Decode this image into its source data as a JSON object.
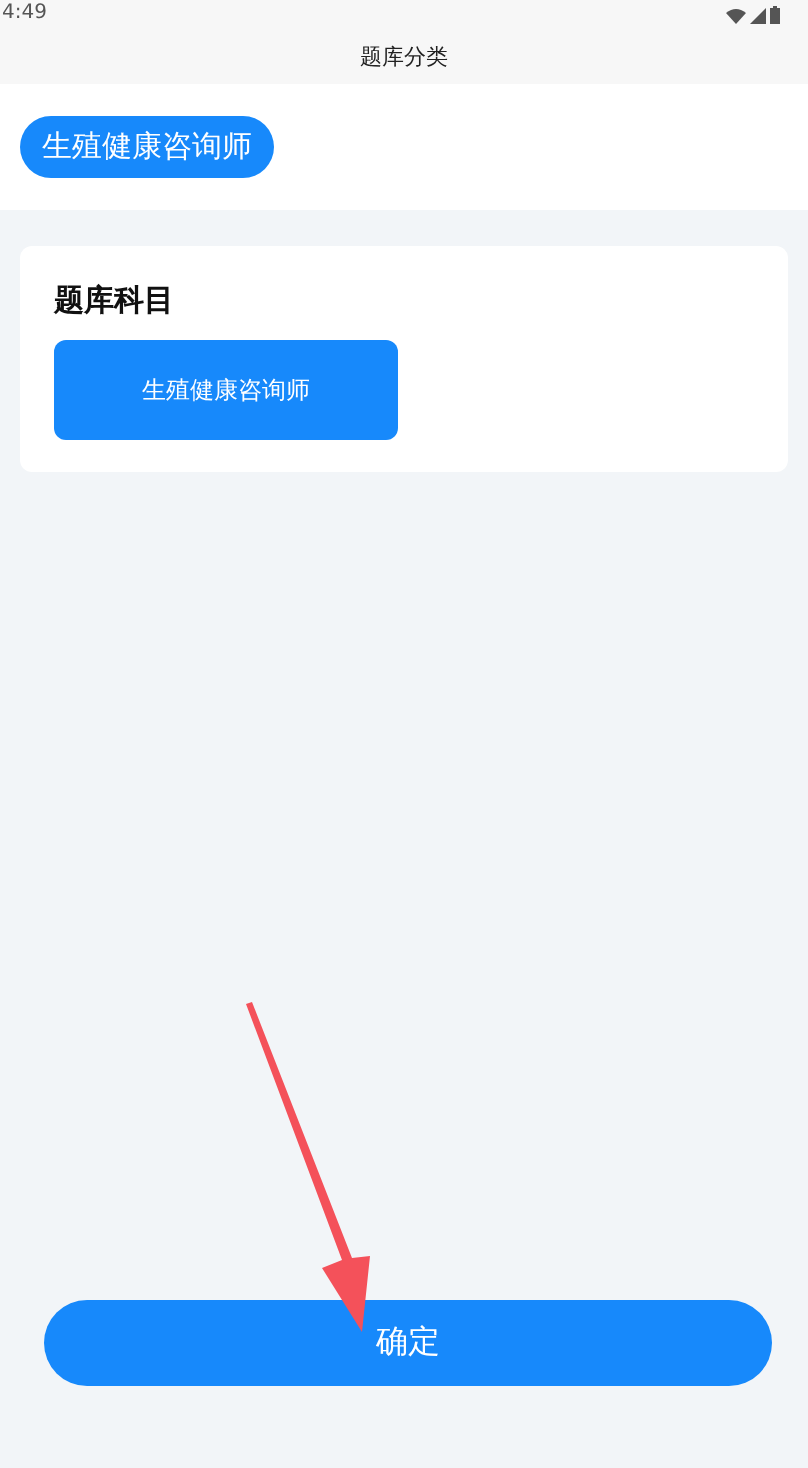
{
  "status_bar": {
    "time": "4:49"
  },
  "header": {
    "title": "题库分类"
  },
  "current_selection": {
    "label": "生殖健康咨询师"
  },
  "subject_card": {
    "title": "题库科目",
    "options": [
      {
        "label": "生殖健康咨询师",
        "selected": true
      }
    ]
  },
  "confirm_button": {
    "label": "确定"
  }
}
